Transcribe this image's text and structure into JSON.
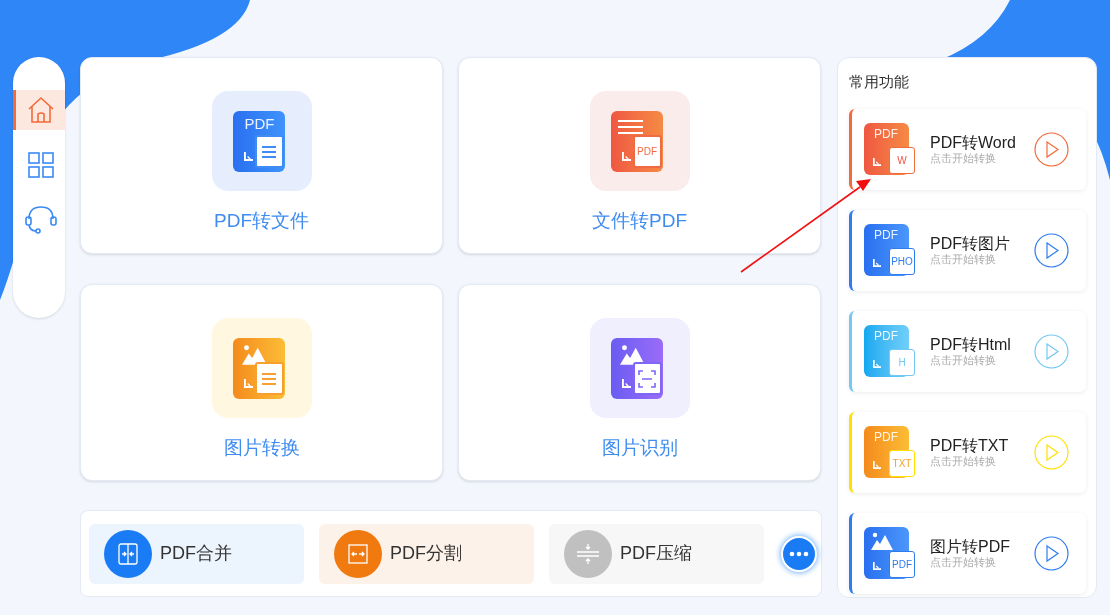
{
  "sidebar": {
    "items": [
      {
        "kind": "home",
        "selected": true
      },
      {
        "kind": "grid",
        "selected": false
      },
      {
        "kind": "headset",
        "selected": false
      }
    ]
  },
  "cards": [
    {
      "kind": "pdf-to-file",
      "label": "PDF转文件",
      "icon_text": "PDF"
    },
    {
      "kind": "file-to-pdf",
      "label": "文件转PDF",
      "icon_text": "PDF"
    },
    {
      "kind": "image-convert",
      "label": "图片转换"
    },
    {
      "kind": "image-recognize",
      "label": "图片识别"
    }
  ],
  "tools": [
    {
      "kind": "merge",
      "label": "PDF合并",
      "color": "#1a7cf5"
    },
    {
      "kind": "split",
      "label": "PDF分割",
      "color": "#f07a10"
    },
    {
      "kind": "compress",
      "label": "PDF压缩",
      "color": "#c0c0c0"
    }
  ],
  "common": {
    "title": "常用功能",
    "items": [
      {
        "kind": "text",
        "title": "PDF转Word",
        "subtitle": "点击开始转换",
        "icon_text": "PDF",
        "badge": "W",
        "color": "#f36a3b"
      },
      {
        "kind": "text",
        "title": "PDF转图片",
        "subtitle": "点击开始转换",
        "icon_text": "PDF",
        "badge": "PHO",
        "color": "#2f7cf0"
      },
      {
        "kind": "text",
        "title": "PDF转Html",
        "subtitle": "点击开始转换",
        "icon_text": "PDF",
        "badge": "H",
        "color": "#74c8f2"
      },
      {
        "kind": "text",
        "title": "PDF转TXT",
        "subtitle": "点击开始转换",
        "icon_text": "PDF",
        "badge": "TXT",
        "color": "#ffe000"
      },
      {
        "kind": "image",
        "title": "图片转PDF",
        "subtitle": "点击开始转换",
        "badge": "PDF",
        "color": "#2f7cf0"
      }
    ]
  }
}
